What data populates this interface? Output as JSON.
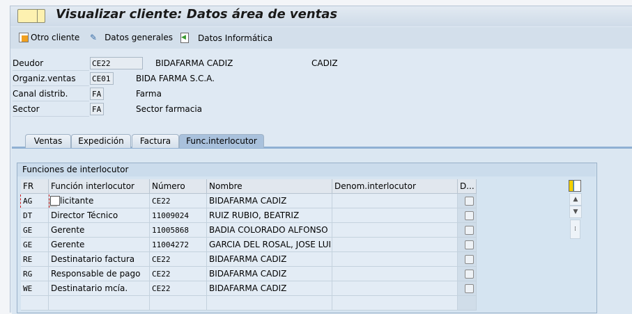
{
  "title": "Visualizar cliente: Datos área de ventas",
  "toolbar": {
    "otro_cliente": "Otro cliente",
    "datos_generales": "Datos generales",
    "datos_informatica": "Datos Informática"
  },
  "header": {
    "deudor": {
      "label": "Deudor",
      "value": "CE22",
      "name": "BIDAFARMA CADIZ",
      "city": "CADIZ"
    },
    "org": {
      "label": "Organiz.ventas",
      "value": "CE01",
      "name": "BIDA FARMA S.C.A."
    },
    "canal": {
      "label": "Canal distrib.",
      "value": "FA",
      "name": "Farma"
    },
    "sector": {
      "label": "Sector",
      "value": "FA",
      "name": "Sector farmacia"
    }
  },
  "tabs": [
    "Ventas",
    "Expedición",
    "Factura",
    "Func.interlocutor"
  ],
  "group_title": "Funciones de interlocutor",
  "columns": [
    "FR",
    "Función interlocutor",
    "Número",
    "Nombre",
    "Denom.interlocutor",
    "D..."
  ],
  "rows": [
    {
      "fr": "AG",
      "funcion": "licitante",
      "numero": "CE22",
      "nombre": "BIDAFARMA CADIZ",
      "denom": ""
    },
    {
      "fr": "DT",
      "funcion": "Director Técnico",
      "numero": "11009024",
      "nombre": "RUIZ RUBIO, BEATRIZ",
      "denom": ""
    },
    {
      "fr": "GE",
      "funcion": "Gerente",
      "numero": "11005868",
      "nombre": "BADIA COLORADO ALFONSO",
      "denom": ""
    },
    {
      "fr": "GE",
      "funcion": "Gerente",
      "numero": "11004272",
      "nombre": "GARCIA DEL ROSAL, JOSE LUIS",
      "denom": ""
    },
    {
      "fr": "RE",
      "funcion": "Destinatario factura",
      "numero": "CE22",
      "nombre": "BIDAFARMA CADIZ",
      "denom": ""
    },
    {
      "fr": "RG",
      "funcion": "Responsable de pago",
      "numero": "CE22",
      "nombre": "BIDAFARMA CADIZ",
      "denom": ""
    },
    {
      "fr": "WE",
      "funcion": "Destinatario mcía.",
      "numero": "CE22",
      "nombre": "BIDAFARMA CADIZ",
      "denom": ""
    }
  ]
}
